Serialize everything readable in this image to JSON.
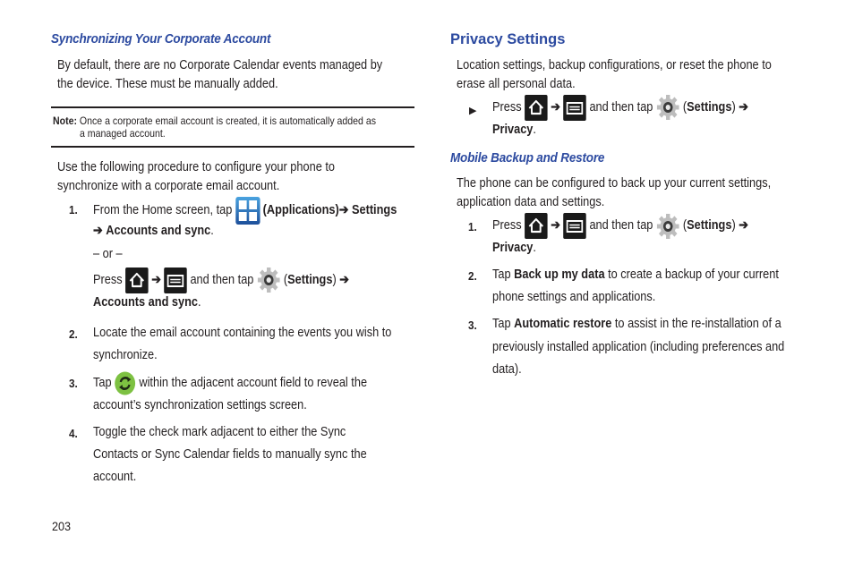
{
  "left": {
    "heading": "Synchronizing Your Corporate Account",
    "intro": [
      "By default, there are no Corporate Calendar events managed by",
      "the device. These must be manually added."
    ],
    "note": {
      "label": "Note:",
      "line1": "Once a corporate email account is created, it is automatically added as",
      "line2": "a managed account."
    },
    "procedure": [
      "Use the following procedure to configure your phone to",
      "synchronize with a corporate email account."
    ],
    "steps": [
      {
        "num": "1.",
        "l1_pre": "From the Home screen, tap",
        "l1_apps": "(Applications)",
        "l1_arrow": "➔",
        "l1_bold": "Settings",
        "l2_arrow": "➔",
        "l2_bold": "Accounts and sync",
        "l2_end": ".",
        "or": "– or –",
        "press": "Press",
        "arrow": "➔",
        "then_tap": "and then tap",
        "settings": "Settings",
        "paren_open": "(",
        "paren_close": ")",
        "final_bold": "Accounts and sync",
        "final_end": "."
      },
      {
        "num": "2.",
        "lines": [
          "Locate the email account containing the events you wish to",
          "synchronize."
        ]
      },
      {
        "num": "3.",
        "pre": "Tap",
        "post": "within the adjacent account field to reveal the",
        "line2": "account’s synchronization settings screen."
      },
      {
        "num": "4.",
        "lines": [
          "Toggle the check mark adjacent to either the Sync",
          "Contacts or Sync Calendar fields to manually sync the",
          "account."
        ]
      }
    ]
  },
  "right": {
    "heading": "Privacy Settings",
    "intro": [
      "Location settings, backup configurations, or reset the phone to",
      "erase all personal data."
    ],
    "bullet": {
      "marker": "▶",
      "press": "Press",
      "arrow": "➔",
      "then_tap": "and then tap",
      "settings": "Settings",
      "paren_open": "(",
      "paren_close": ")",
      "final_bold": "Privacy",
      "final_end": "."
    },
    "subheading": "Mobile Backup and Restore",
    "sub_intro": [
      "The phone can be configured to back up your current settings,",
      "application data and settings."
    ],
    "steps": [
      {
        "num": "1.",
        "press": "Press",
        "arrow": "➔",
        "then_tap": "and then tap",
        "settings": "Settings",
        "paren_open": "(",
        "paren_close": ")",
        "final_bold": "Privacy",
        "final_end": "."
      },
      {
        "num": "2.",
        "pre": "Tap",
        "bold": "Back up my data",
        "post": "to create a backup of your current",
        "line2": "phone settings and applications."
      },
      {
        "num": "3.",
        "pre": "Tap",
        "bold": "Automatic restore",
        "post": "to assist in the re-installation of a",
        "line2": "previously installed application (including preferences and",
        "line3": "data)."
      }
    ]
  },
  "page_number": "203",
  "colors": {
    "heading": "#2c4aa0",
    "text": "#231f20"
  },
  "icons": [
    "applications-icon",
    "home-key-icon",
    "menu-key-icon",
    "settings-gear-icon",
    "sync-icon"
  ]
}
